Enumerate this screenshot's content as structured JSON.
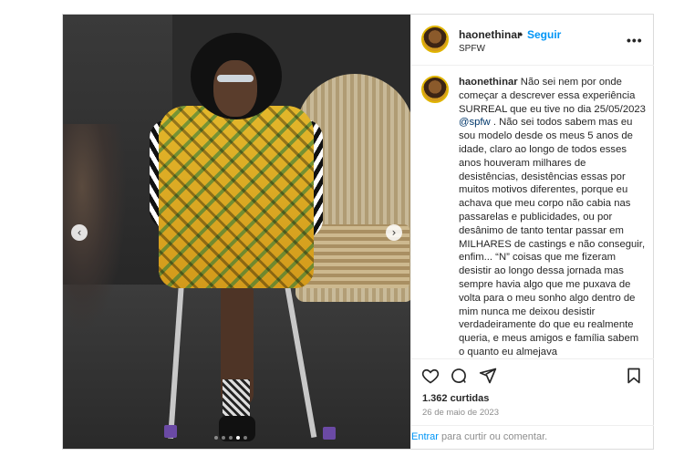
{
  "post": {
    "username": "haonethinar",
    "follow_separator": "•",
    "follow_label": "Seguir",
    "location": "SPFW",
    "more_icon": "•••",
    "caption": {
      "username": "haonethinar",
      "text_before_mention": "Não sei nem por onde começar a descrever essa experiência SURREAL que eu tive no dia 25/05/2023",
      "mention": "@spfw",
      "text_after_mention": ". Não sei todos sabem mas eu sou modelo desde os meus 5 anos de idade, claro ao longo de todos esses anos houveram milhares de desistências, desistências essas por muitos motivos diferentes, porque eu achava que meu corpo não cabia nas passarelas e publicidades, ou por desânimo de tanto tentar passar em MILHARES de castings e não conseguir, enfim... “N” coisas que me fizeram desistir ao longo dessa jornada mas sempre havia algo que me puxava de volta para o meu sonho algo dentro de mim nunca me deixou desistir verdadeiramente do que eu realmente queria, e meus amigos e família sabem o quanto eu almejava"
    },
    "likes": "1.362 curtidas",
    "date": "26 de maio de 2023",
    "login": {
      "link": "Entrar",
      "rest": " para curtir ou comentar."
    }
  },
  "media": {
    "prev_icon": "‹",
    "next_icon": "›",
    "slide_count": 5,
    "active_slide": 4
  },
  "colors": {
    "link": "#0095f6",
    "mention": "#00376b",
    "muted": "#8e8e8e"
  },
  "icons": {
    "like": "heart-icon",
    "comment": "comment-icon",
    "share": "send-icon",
    "save": "bookmark-icon"
  }
}
